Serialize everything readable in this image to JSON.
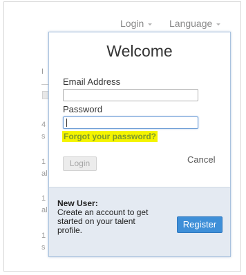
{
  "topnav": {
    "login_label": "Login",
    "language_label": "Language"
  },
  "background": {
    "fragments": [
      "I",
      "4",
      "s",
      "1",
      "al",
      "1",
      "al",
      "1",
      "s"
    ]
  },
  "dialog": {
    "title": "Welcome",
    "email_label": "Email Address",
    "email_value": "",
    "password_label": "Password",
    "password_value": "",
    "forgot_link": "Forgot your password?",
    "login_button": "Login",
    "cancel_link": "Cancel",
    "new_user_title": "New User:",
    "new_user_text": "Create an account to get started on your talent profile.",
    "register_button": "Register"
  },
  "colors": {
    "highlight": "#f4f400",
    "link": "#7f9a2c",
    "register_button": "#3e8fd8",
    "panel_background": "#e4eaf2",
    "dialog_border": "#a9c2de"
  },
  "icons": {
    "nav_caret": "caret-down-icon"
  }
}
